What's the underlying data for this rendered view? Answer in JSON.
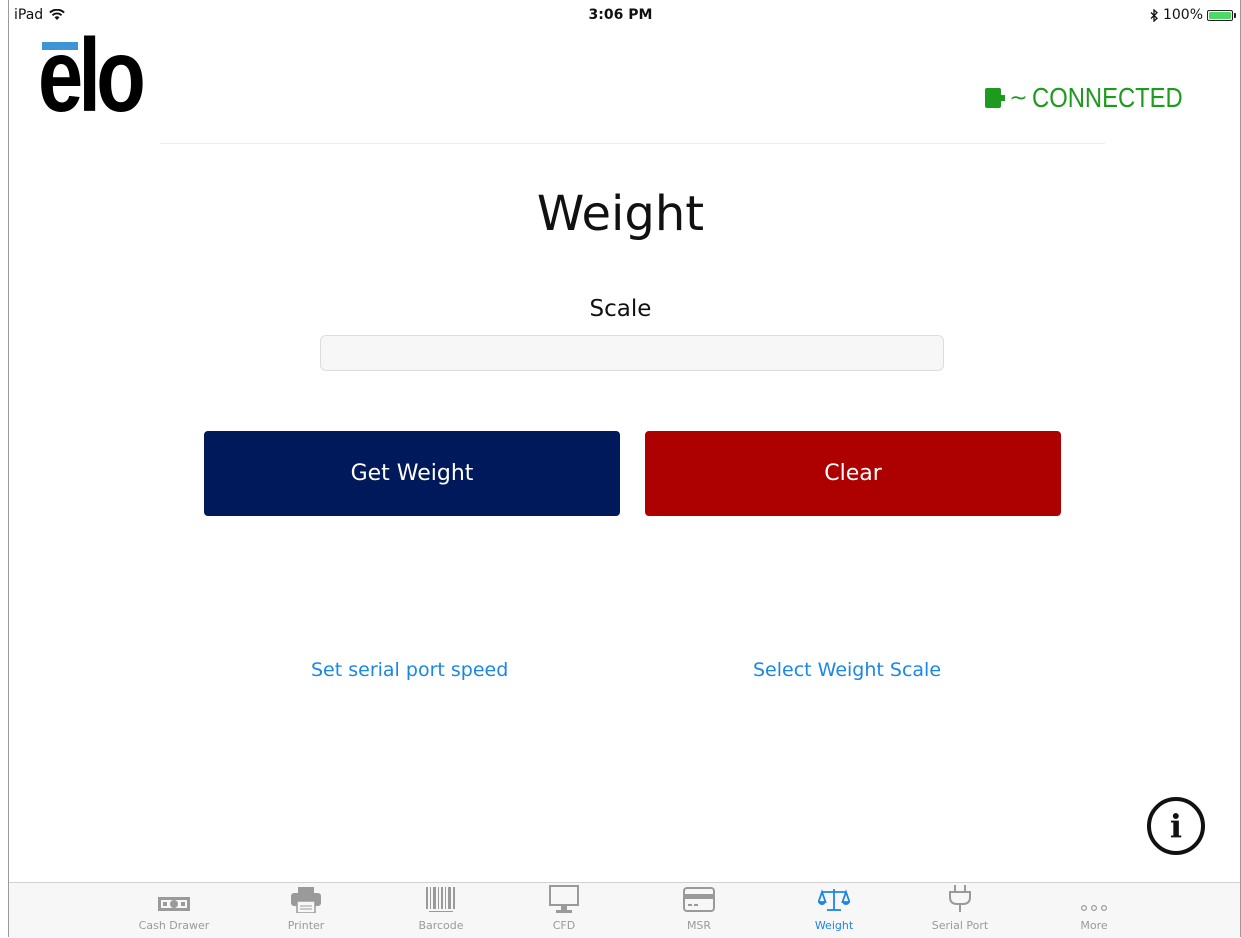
{
  "status_bar": {
    "device": "iPad",
    "time": "3:06 PM",
    "battery": "100%",
    "battery_level": 1.0
  },
  "header": {
    "logo_text": "elo",
    "connection_status": "CONNECTED",
    "connection_color": "#1e9a1e"
  },
  "main": {
    "title": "Weight",
    "scale_label": "Scale",
    "scale_value": "",
    "get_weight_label": "Get Weight",
    "clear_label": "Clear",
    "serial_speed_link": "Set serial port speed",
    "select_scale_link": "Select Weight Scale"
  },
  "colors": {
    "get_weight_button": "#00195a",
    "clear_button": "#ad0000",
    "link": "#1a86e8",
    "active_tab": "#1a86e8",
    "logo_accent": "#3e95d6"
  },
  "tabs": [
    {
      "label": "Cash Drawer",
      "icon": "cash-drawer-icon",
      "active": false
    },
    {
      "label": "Printer",
      "icon": "printer-icon",
      "active": false
    },
    {
      "label": "Barcode",
      "icon": "barcode-icon",
      "active": false
    },
    {
      "label": "CFD",
      "icon": "monitor-icon",
      "active": false
    },
    {
      "label": "MSR",
      "icon": "card-icon",
      "active": false
    },
    {
      "label": "Weight",
      "icon": "scale-icon",
      "active": true
    },
    {
      "label": "Serial Port",
      "icon": "plug-icon",
      "active": false
    },
    {
      "label": "More",
      "icon": "more-icon",
      "active": false
    }
  ]
}
